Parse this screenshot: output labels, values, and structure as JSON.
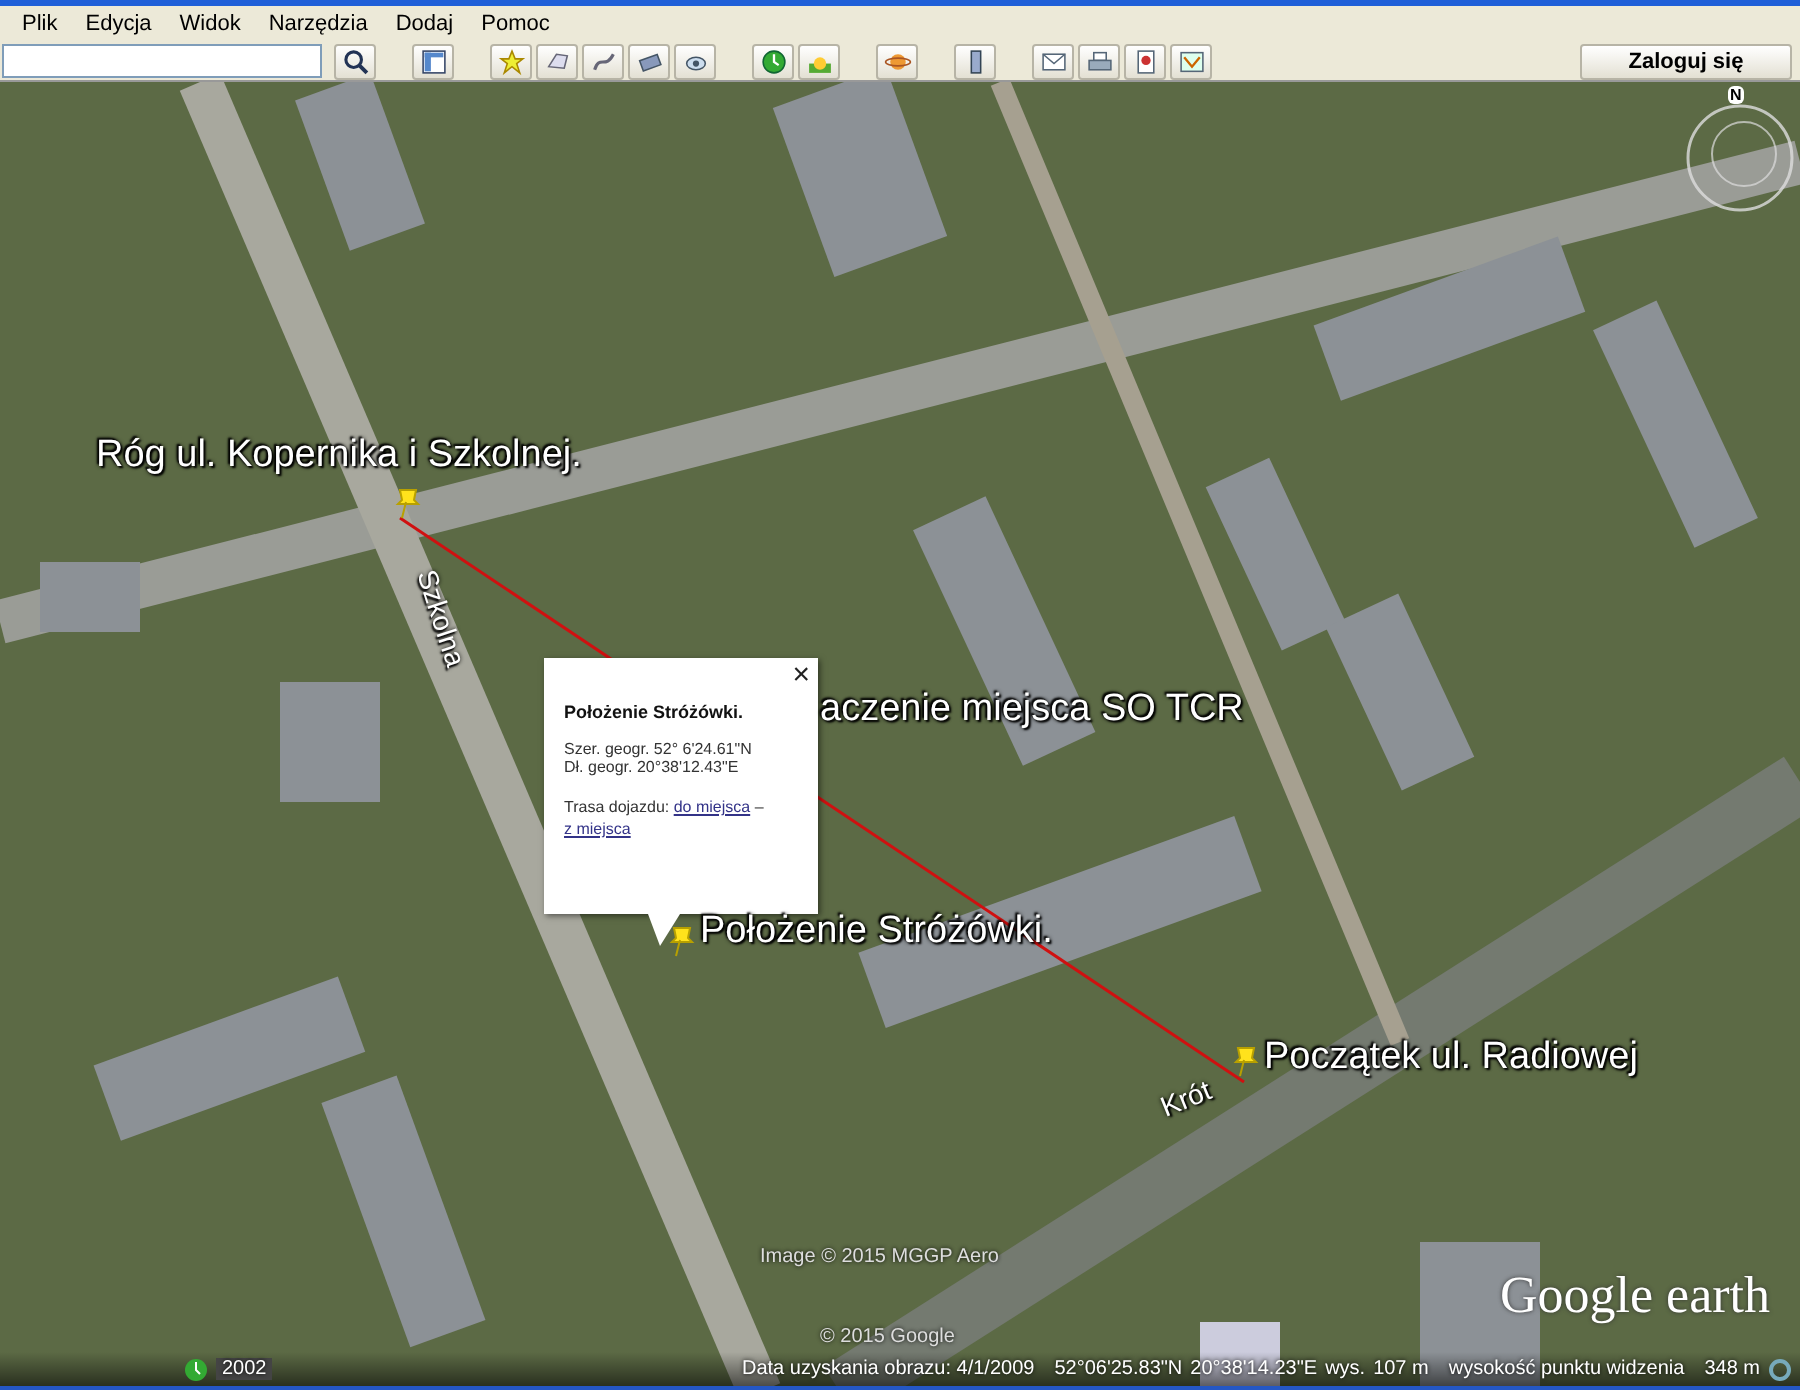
{
  "menu": [
    "Plik",
    "Edycja",
    "Widok",
    "Narzędzia",
    "Dodaj",
    "Pomoc"
  ],
  "signin_button": "Zaloguj się",
  "compass": {
    "north": "N"
  },
  "placemarks": [
    {
      "label": "Róg ul. Kopernika i Szkolnej."
    },
    {
      "label": "aczenie miejsca SO TCR"
    },
    {
      "label": "Położenie Stróżówki."
    },
    {
      "label": "Początek ul. Radiowej"
    }
  ],
  "street_labels": [
    "Szkolna",
    "Krót"
  ],
  "popup": {
    "title": "Położenie Stróżówki.",
    "lat": "Szer. geogr. 52° 6'24.61\"N",
    "lon": "Dł. geogr. 20°38'12.43\"E",
    "route_label": "Trasa dojazdu:",
    "links": [
      "do miejsca",
      "z miejsca"
    ],
    "separator": "–",
    "close": "×"
  },
  "attribution": [
    "Image © 2015 MGGP Aero",
    "© 2015 Google"
  ],
  "logo": "Google earth",
  "timeline": {
    "year": "2002"
  },
  "status": {
    "date": "Data uzyskania obrazu: 4/1/2009",
    "lat": "52°06'25.83\"N",
    "lon": "20°38'14.23\"E",
    "elev_label": "wys.",
    "elev": "107 m",
    "eye_label": "wysokość punktu widzenia",
    "eye": "348 m"
  }
}
